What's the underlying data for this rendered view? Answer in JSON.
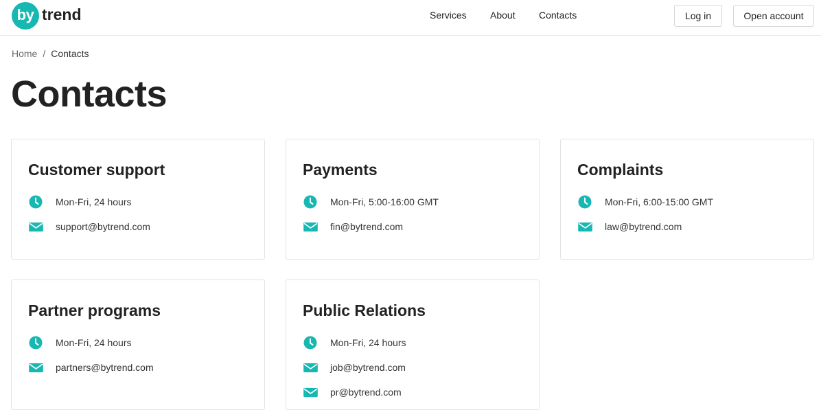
{
  "brand": {
    "logo_mark": "by",
    "logo_word": "trend",
    "accent_color": "#17b7b2"
  },
  "nav": {
    "items": [
      "Services",
      "About",
      "Contacts"
    ]
  },
  "header_buttons": {
    "login_label": "Log in",
    "open_account_label": "Open account"
  },
  "breadcrumb": {
    "home": "Home",
    "separator": "/",
    "current": "Contacts"
  },
  "page_title": "Contacts",
  "icons": {
    "hours": "clock-icon",
    "email": "envelope-icon"
  },
  "cards": [
    {
      "title": "Customer support",
      "hours": "Mon-Fri, 24 hours",
      "emails": [
        "support@bytrend.com"
      ]
    },
    {
      "title": "Payments",
      "hours": "Mon-Fri, 5:00-16:00 GMT",
      "emails": [
        "fin@bytrend.com"
      ]
    },
    {
      "title": "Complaints",
      "hours": "Mon-Fri, 6:00-15:00 GMT",
      "emails": [
        "law@bytrend.com"
      ]
    },
    {
      "title": "Partner programs",
      "hours": "Mon-Fri, 24 hours",
      "emails": [
        "partners@bytrend.com"
      ]
    },
    {
      "title": "Public Relations",
      "hours": "Mon-Fri, 24 hours",
      "emails": [
        "job@bytrend.com",
        "pr@bytrend.com"
      ]
    }
  ]
}
